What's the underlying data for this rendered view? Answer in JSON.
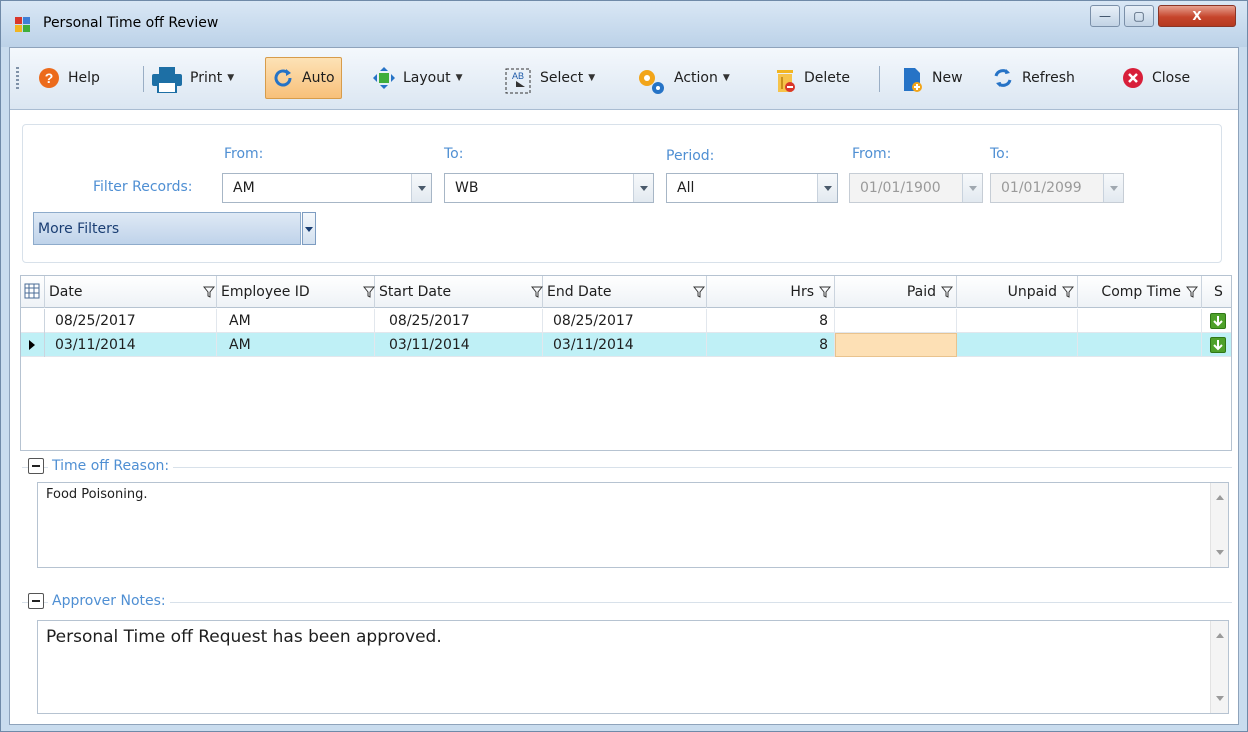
{
  "window": {
    "title": "Personal Time off Review",
    "controls": {
      "minimize": "—",
      "maximize": "▢",
      "close": "X"
    }
  },
  "toolbar": {
    "help_label": "Help",
    "print_label": "Print",
    "auto_label": "Auto",
    "layout_label": "Layout",
    "select_label": "Select",
    "action_label": "Action",
    "delete_label": "Delete",
    "new_label": "New",
    "refresh_label": "Refresh",
    "close_label": "Close"
  },
  "filter": {
    "filter_records_label": "Filter Records:",
    "from_label": "From:",
    "to_label": "To:",
    "period_label": "Period:",
    "date_from_label": "From:",
    "date_to_label": "To:",
    "from_value": "AM",
    "to_value": "WB",
    "period_value": "All",
    "date_from_value": "01/01/1900",
    "date_to_value": "01/01/2099",
    "more_filters_label": "More Filters"
  },
  "grid": {
    "columns": [
      "Date",
      "Employee ID",
      "Start Date",
      "End Date",
      "Hrs",
      "Paid",
      "Unpaid",
      "Comp Time",
      "S"
    ],
    "rows": [
      {
        "date": "08/25/2017",
        "employee_id": "AM",
        "start_date": "08/25/2017",
        "end_date": "08/25/2017",
        "hrs": "8",
        "paid": "",
        "unpaid": "",
        "comp_time": ""
      },
      {
        "date": "03/11/2014",
        "employee_id": "AM",
        "start_date": "03/11/2014",
        "end_date": "03/11/2014",
        "hrs": "8",
        "paid": "",
        "unpaid": "",
        "comp_time": ""
      }
    ],
    "selected_row_index": 1
  },
  "time_off_reason": {
    "label": "Time off Reason:",
    "text": "Food Poisoning."
  },
  "approver_notes": {
    "label": "Approver Notes:",
    "text": "Personal Time off Request has been approved."
  },
  "colors": {
    "accent_label": "#4f8fd3",
    "selected_row": "#bff0f6",
    "pressed_button": "#f8c07a",
    "editing_cell": "#fde0b5"
  }
}
